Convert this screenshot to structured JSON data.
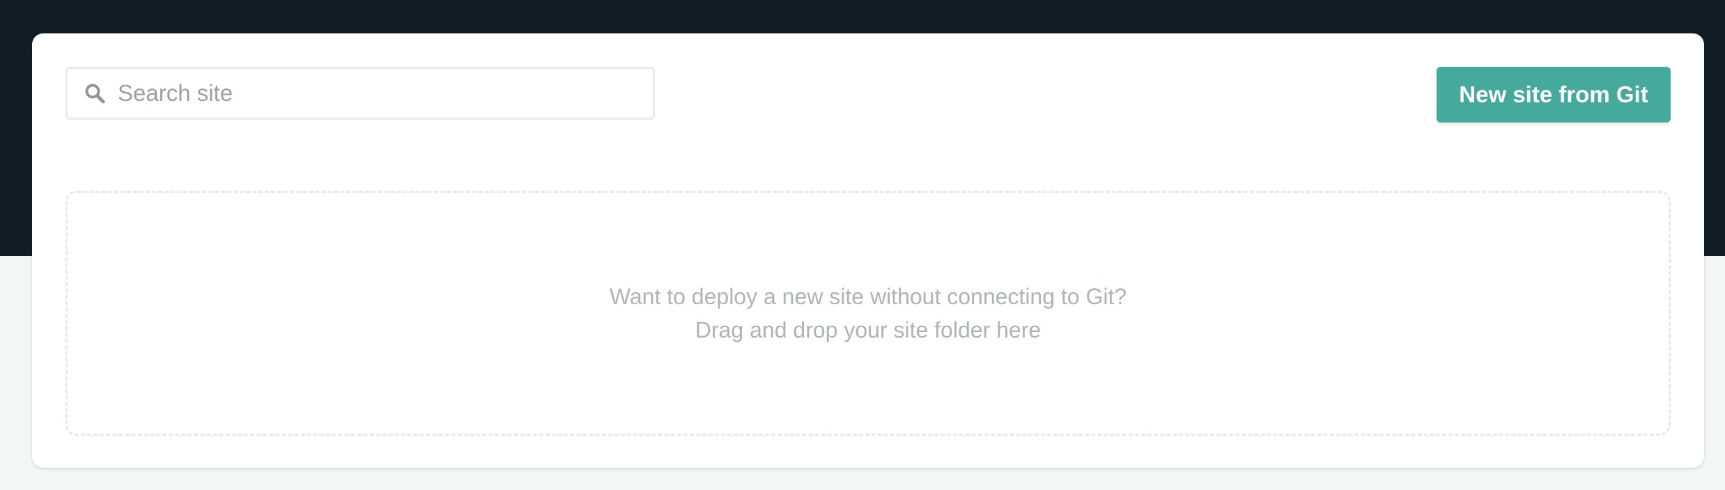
{
  "search": {
    "placeholder": "Search site",
    "icon": "search-icon"
  },
  "actions": {
    "new_site_label": "New site from Git"
  },
  "dropzone": {
    "line1": "Want to deploy a new site without connecting to Git?",
    "line2": "Drag and drop your site folder here"
  },
  "colors": {
    "header_background": "#111c26",
    "page_background": "#f3f6f7",
    "card_background": "#ffffff",
    "primary_button": "#45a99b",
    "muted_text": "#aeb3b6"
  }
}
